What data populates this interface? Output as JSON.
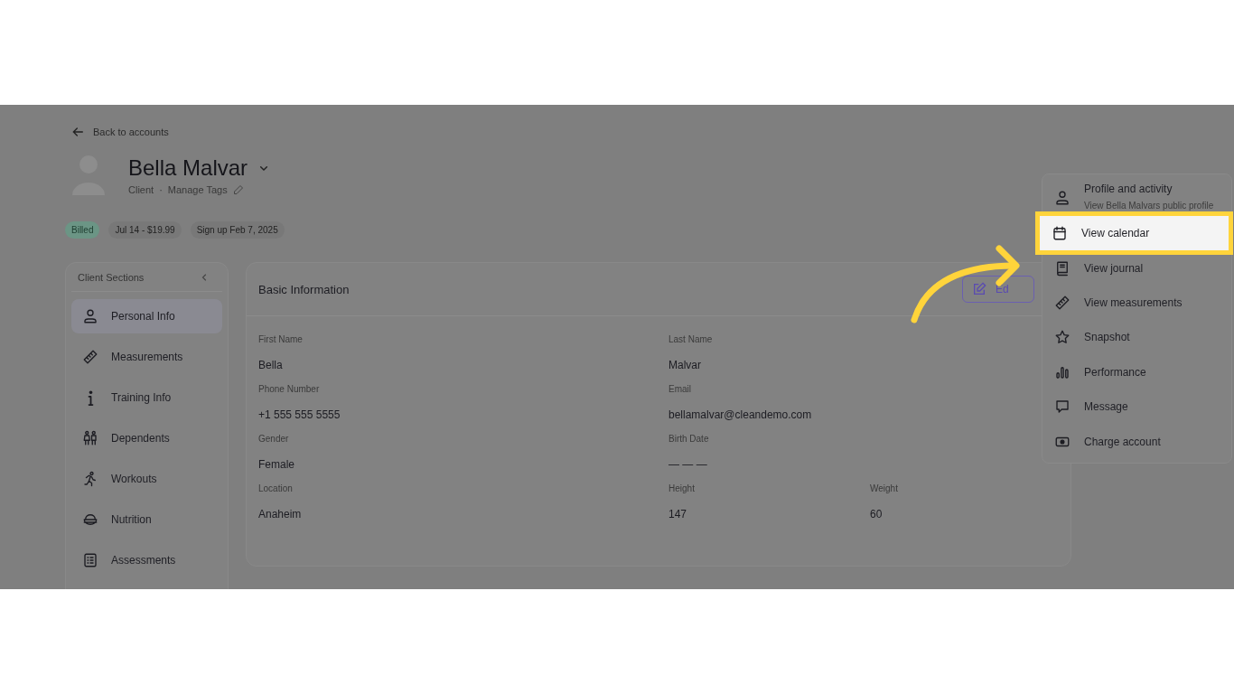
{
  "back_link": "Back to accounts",
  "client": {
    "name": "Bella Malvar",
    "role": "Client",
    "separator": "·",
    "manage_tags": "Manage Tags"
  },
  "badges": [
    {
      "label": "Billed",
      "kind": "status"
    },
    {
      "label": "Jul 14 - $19.99",
      "kind": "plain"
    },
    {
      "label": "Sign up Feb 7, 2025",
      "kind": "plain"
    }
  ],
  "sidebar": {
    "title": "Client Sections",
    "items": [
      {
        "label": "Personal Info",
        "selected": true
      },
      {
        "label": "Measurements",
        "selected": false
      },
      {
        "label": "Training Info",
        "selected": false
      },
      {
        "label": "Dependents",
        "selected": false
      },
      {
        "label": "Workouts",
        "selected": false
      },
      {
        "label": "Nutrition",
        "selected": false
      },
      {
        "label": "Assessments",
        "selected": false
      }
    ]
  },
  "basic_information": {
    "title": "Basic Information",
    "edit_button": "Ed",
    "rows": [
      [
        {
          "label": "First Name",
          "value": "Bella"
        },
        {
          "label": "Last Name",
          "value": "Malvar"
        }
      ],
      [
        {
          "label": "Phone Number",
          "value": "+1 555 555 5555"
        },
        {
          "label": "Email",
          "value": "bellamalvar@cleandemo.com"
        }
      ],
      [
        {
          "label": "Gender",
          "value": "Female"
        },
        {
          "label": "Birth Date",
          "value": "— — —"
        }
      ],
      [
        {
          "label": "Location",
          "value": "Anaheim"
        },
        {
          "label": "Height",
          "value": "147"
        },
        {
          "label": "Weight",
          "value": "60"
        }
      ]
    ]
  },
  "menu": [
    {
      "title": "Profile and activity",
      "subtitle": "View Bella Malvars public profile",
      "selected": false
    },
    {
      "title": "View calendar",
      "selected": true
    },
    {
      "title": "View journal",
      "selected": false
    },
    {
      "title": "View measurements",
      "selected": false
    },
    {
      "title": "Snapshot",
      "selected": false
    },
    {
      "title": "Performance",
      "selected": false
    },
    {
      "title": "Message",
      "selected": false
    },
    {
      "title": "Charge account",
      "selected": false
    }
  ]
}
